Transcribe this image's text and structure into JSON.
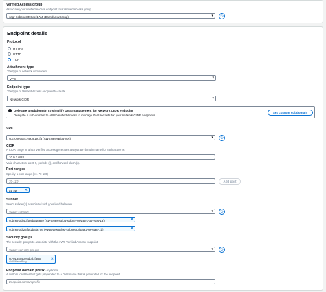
{
  "verified_access_group": {
    "label": "Verified Access group",
    "description": "Associate your Verified Access endpoint to a Verified Access group.",
    "value": "vagr-0ebc6e3496eef17a5 (BrandNewGroup)"
  },
  "endpoint_details": {
    "title": "Endpoint details",
    "protocol": {
      "label": "Protocol",
      "options": [
        "HTTPS",
        "HTTP",
        "TCP"
      ],
      "selected": "TCP"
    },
    "attachment_type": {
      "label": "Attachment type",
      "description": "The type of network component.",
      "value": "VPC"
    },
    "endpoint_type": {
      "label": "Endpoint type",
      "description": "The type of Verified Access endpoint to create.",
      "value": "Network CIDR"
    },
    "delegate": {
      "title": "Delegate a subdomain to simplify DNS management for Network CIDR endpoint",
      "text": "Delegate a sub-domain to AWS Verified Access to manage DNS records for your network CIDR endpoints.",
      "button": "Set custom subdomain"
    },
    "vpc": {
      "label": "VPC",
      "value": "vpc-00ec06c7a93e191fa (AWSNewsBlog-vpc)"
    },
    "cidr": {
      "label": "CIDR",
      "description": "A CIDR range in which Verified Access generates a separate domain name for each active IP.",
      "value": "10.0.1.0/24",
      "hint": "Valid characters are 0-9, periods (.), and forward slash (/)."
    },
    "port_ranges": {
      "label": "Port ranges",
      "description": "Specify a port range (ex. 70-110)",
      "placeholder": "70-110",
      "add_button": "Add port",
      "tokens": [
        "22-22"
      ]
    },
    "subnet": {
      "label": "Subnet",
      "description": "Select subnet(s) associated with your load balancer.",
      "placeholder": "Select subnets",
      "tokens": [
        "subnet-0df4cf48eb51e83e (AWSNewsBlog-subnet-private1-us-east-1a)",
        "subnet-0df23f4c2b4fa75e (AWSNewsBlog-subnet-private2-us-east-1b)"
      ]
    },
    "security_groups": {
      "label": "Security groups",
      "description": "The security groups to associate with the AWS Verified Access endpoint.",
      "placeholder": "Select security groups",
      "token_id": "sg-0134c407edcd7fa96",
      "token_name": "AWSNewsBlog"
    },
    "domain_prefix": {
      "label": "Endpoint domain prefix",
      "optional": "- optional",
      "description": "A custom identifier that gets prepended to a DNS name that is generated for the endpoint.",
      "placeholder": "Endpoint domain prefix"
    }
  },
  "icons": {
    "refresh": "refresh-icon",
    "dropdown": "caret-down-icon",
    "remove": "close-icon",
    "info": "info-icon"
  },
  "colors": {
    "accent": "#0972d3",
    "token_bg": "#f1faff",
    "border": "#7d8998"
  }
}
